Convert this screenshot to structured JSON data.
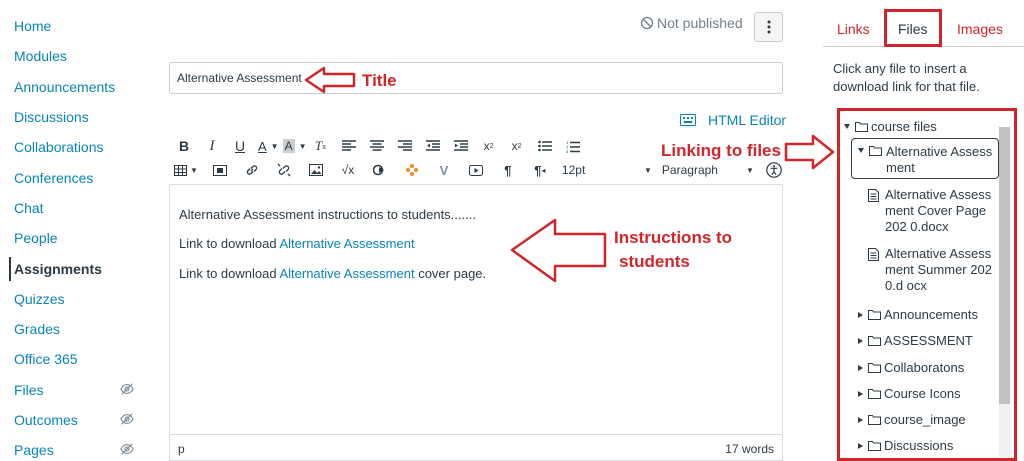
{
  "nav": {
    "items": [
      {
        "label": "Home",
        "hidden": false
      },
      {
        "label": "Modules",
        "hidden": false
      },
      {
        "label": "Announcements",
        "hidden": false
      },
      {
        "label": "Discussions",
        "hidden": false
      },
      {
        "label": "Collaborations",
        "hidden": false
      },
      {
        "label": "Conferences",
        "hidden": false
      },
      {
        "label": "Chat",
        "hidden": false
      },
      {
        "label": "People",
        "hidden": false
      },
      {
        "label": "Assignments",
        "hidden": false,
        "active": true
      },
      {
        "label": "Quizzes",
        "hidden": false
      },
      {
        "label": "Grades",
        "hidden": false
      },
      {
        "label": "Office 365",
        "hidden": false
      },
      {
        "label": "Files",
        "hidden": true
      },
      {
        "label": "Outcomes",
        "hidden": true
      },
      {
        "label": "Pages",
        "hidden": true
      }
    ]
  },
  "header": {
    "publish_status": "Not published"
  },
  "editor": {
    "title_value": "Alternative Assessment",
    "html_editor_label": "HTML Editor",
    "font_size": "12pt",
    "block_format": "Paragraph",
    "paragraphs": {
      "line1": "Alternative Assessment instructions to students.......",
      "line2_prefix": "Link to download ",
      "line2_link": "Alternative Assessment",
      "line3_prefix": "Link to download ",
      "line3_link": "Alternative Assessment",
      "line3_suffix": " cover page."
    },
    "status_path": "p",
    "word_count": "17 words"
  },
  "annotations": {
    "title": "Title",
    "linking": "Linking to files",
    "instructions_line1": "Instructions to",
    "instructions_line2": "students",
    "color": "#d0262a"
  },
  "sidebar": {
    "tabs": {
      "links": "Links",
      "files": "Files",
      "images": "Images"
    },
    "hint": "Click any file to insert a download link for that file.",
    "tree": {
      "root": "course files",
      "focused_folder": "Alternative Assess ment",
      "files": [
        "Alternative Assess ment Cover Page 202 0.docx",
        "Alternative Assess ment Summer 2020.d ocx"
      ],
      "folders": [
        "Announcements",
        "ASSESSMENT",
        "Collaboratons",
        "Course Icons",
        "course_image",
        "Discussions"
      ]
    }
  },
  "colors": {
    "link": "#0a84b6",
    "text": "#2d3b45",
    "accent": "#d0262a"
  }
}
